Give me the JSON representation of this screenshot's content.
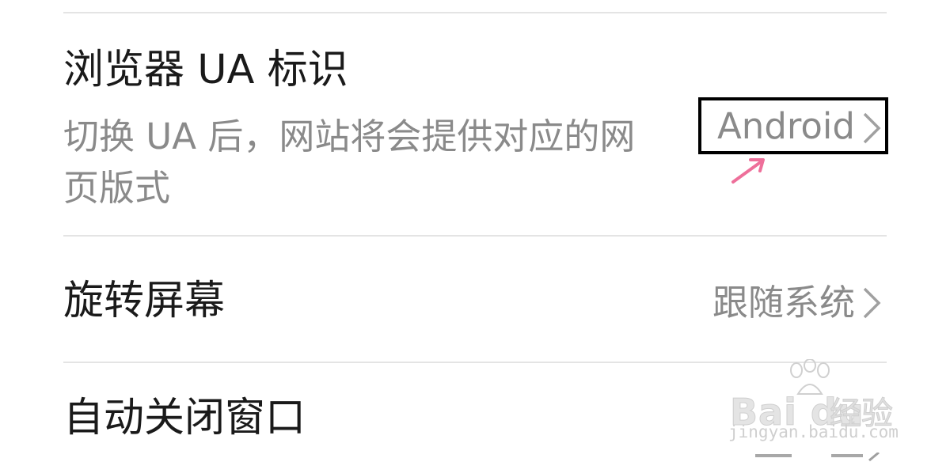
{
  "settings": {
    "ua": {
      "title": "浏览器 UA 标识",
      "description": "切换 UA 后，网站将会提供对应的网页版式",
      "value": "Android"
    },
    "rotate": {
      "title": "旋转屏幕",
      "value": "跟随系统"
    },
    "auto_close": {
      "title": "自动关闭窗口"
    }
  },
  "watermark": {
    "brand": "Bai du",
    "label": "经验",
    "url": "jingyan.baidu.com"
  },
  "colors": {
    "title": "#1a1a1a",
    "secondary": "#8a8a8a",
    "divider": "#e4e4e4",
    "annotation_arrow": "#ee6f9a",
    "highlight_box": "#000000"
  }
}
